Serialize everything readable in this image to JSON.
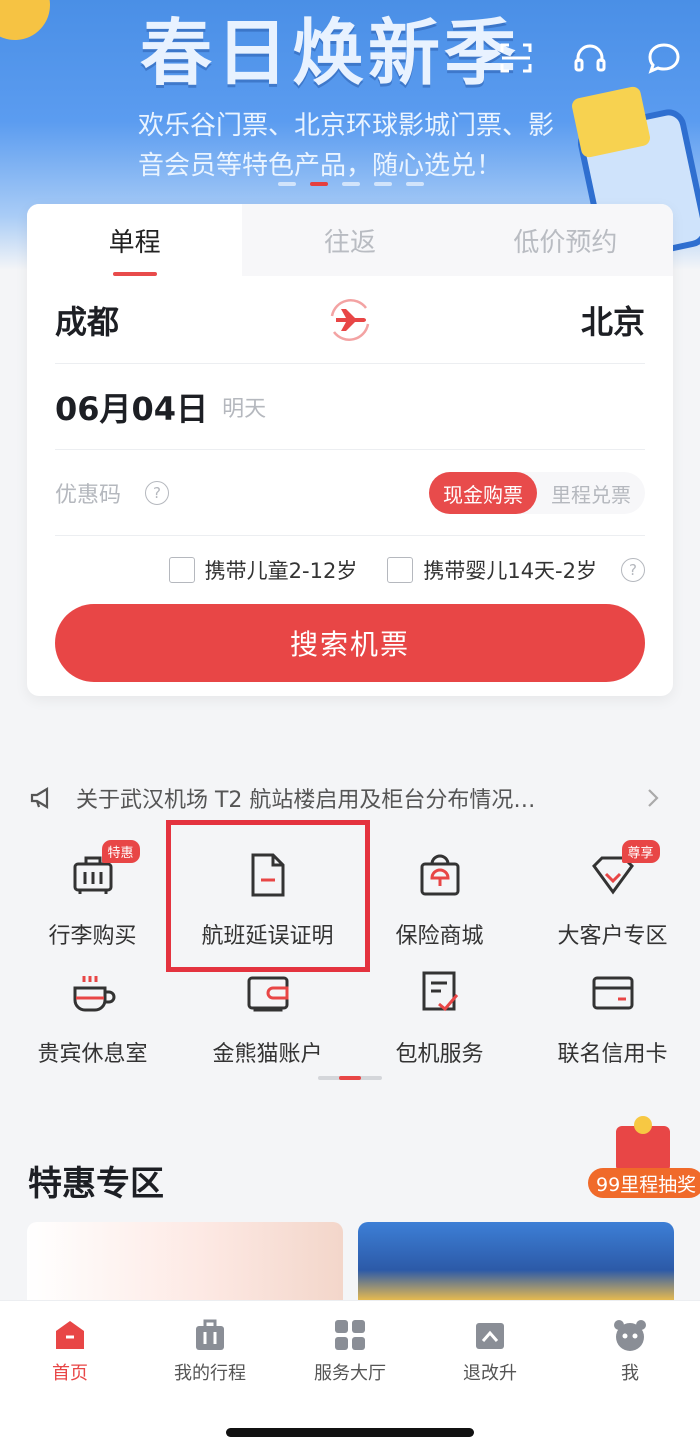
{
  "banner": {
    "title": "春日焕新季",
    "text": "欢乐谷门票、北京环球影城门票、影音会员等特色产品，随心选兑！"
  },
  "top_icons": [
    "scan-icon",
    "headset-icon",
    "chat-icon"
  ],
  "booking": {
    "tabs": [
      {
        "label": "单程",
        "active": true
      },
      {
        "label": "往返",
        "active": false
      },
      {
        "label": "低价预约",
        "active": false
      }
    ],
    "from_city": "成都",
    "to_city": "北京",
    "date": "06月04日",
    "date_hint": "明天",
    "promo_placeholder": "优惠码",
    "promo_help": "?",
    "payment_modes": [
      {
        "label": "现金购票",
        "active": true
      },
      {
        "label": "里程兑票",
        "active": false
      }
    ],
    "options": [
      {
        "label": "携带儿童2-12岁",
        "checked": false
      },
      {
        "label": "携带婴儿14天-2岁",
        "checked": false
      }
    ],
    "options_help": "?",
    "search_label": "搜索机票"
  },
  "notice": {
    "text": "关于武汉机场 T2 航站楼启用及柜台分布情况…"
  },
  "services": [
    {
      "label": "行李购买",
      "icon": "luggage-icon",
      "badge": "特惠"
    },
    {
      "label": "航班延误证明",
      "icon": "document-icon",
      "badge": ""
    },
    {
      "label": "保险商城",
      "icon": "insurance-bag-icon",
      "badge": ""
    },
    {
      "label": "大客户专区",
      "icon": "vip-shield-icon",
      "badge": "尊享"
    },
    {
      "label": "贵宾休息室",
      "icon": "coffee-cup-icon",
      "badge": ""
    },
    {
      "label": "金熊猫账户",
      "icon": "wallet-icon",
      "badge": ""
    },
    {
      "label": "包机服务",
      "icon": "checklist-icon",
      "badge": ""
    },
    {
      "label": "联名信用卡",
      "icon": "credit-card-icon",
      "badge": ""
    }
  ],
  "special": {
    "title": "特惠专区",
    "lottery_label": "99里程抽奖"
  },
  "tabbar": [
    {
      "label": "首页",
      "active": true
    },
    {
      "label": "我的行程",
      "active": false
    },
    {
      "label": "服务大厅",
      "active": false
    },
    {
      "label": "退改升",
      "active": false
    },
    {
      "label": "我",
      "active": false
    }
  ],
  "colors": {
    "accent": "#e84646",
    "highlight_box": "#e4333f",
    "banner": "#5b9cf0"
  }
}
